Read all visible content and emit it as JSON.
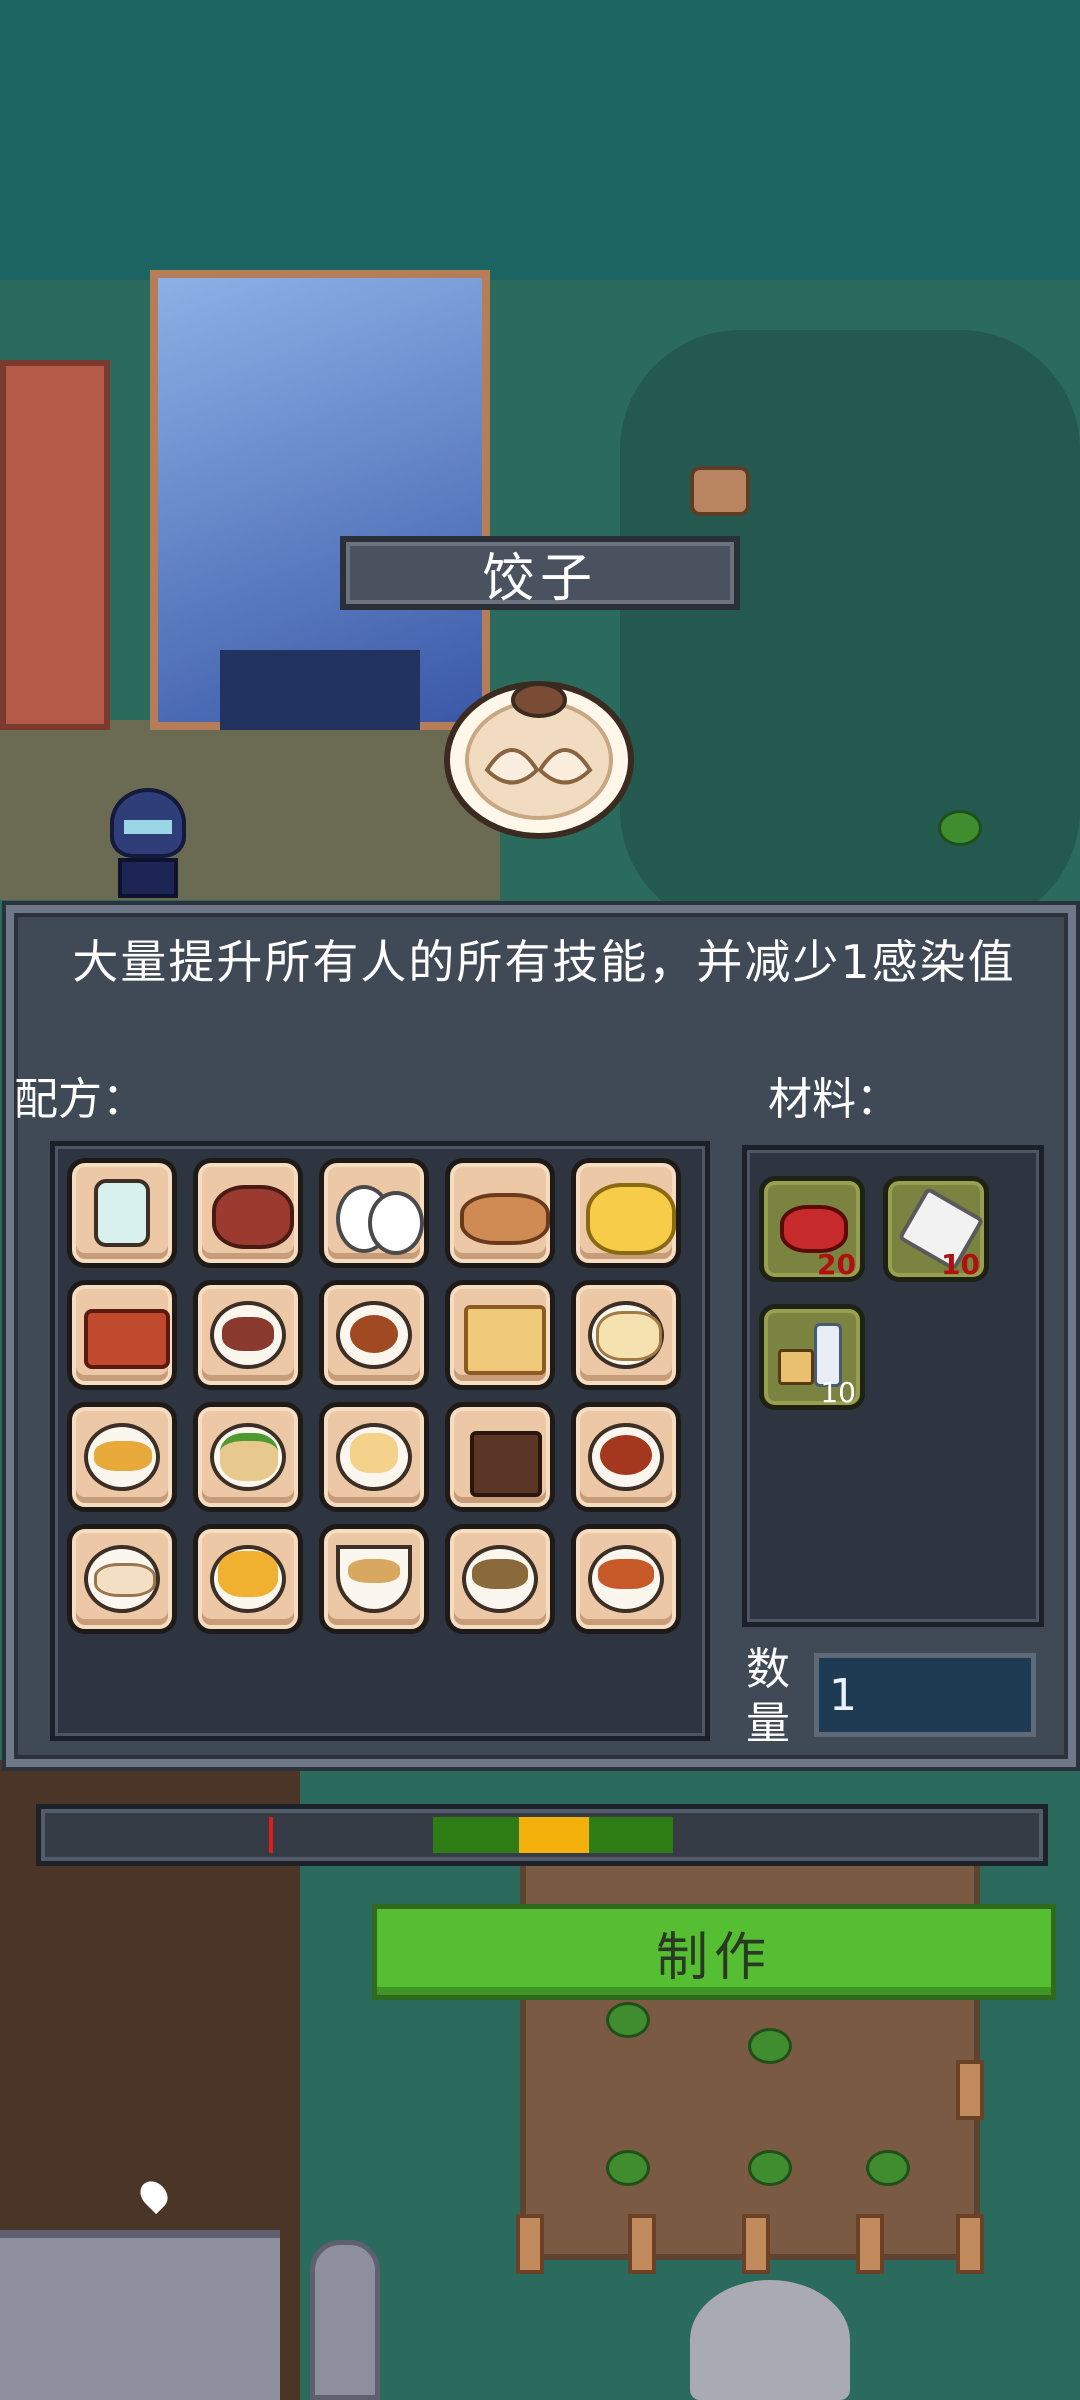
{
  "dish": {
    "name": "饺子"
  },
  "panel": {
    "description": "大量提升所有人的所有技能，并减少1感染值",
    "recipe_label": "配方：",
    "materials_label": "材料：",
    "recipes": [
      {
        "icon": "water-glass-icon"
      },
      {
        "icon": "steak-icon"
      },
      {
        "icon": "eggs-icon"
      },
      {
        "icon": "bread-icon"
      },
      {
        "icon": "scrambled-eggs-icon"
      },
      {
        "icon": "bacon-icon"
      },
      {
        "icon": "meat-platter-icon"
      },
      {
        "icon": "spaghetti-icon"
      },
      {
        "icon": "toast-icon"
      },
      {
        "icon": "pancake-icon"
      },
      {
        "icon": "taco-icon"
      },
      {
        "icon": "sandwich-icon"
      },
      {
        "icon": "bread-plate-icon"
      },
      {
        "icon": "cake-slice-icon"
      },
      {
        "icon": "meatballs-icon"
      },
      {
        "icon": "dumplings-icon"
      },
      {
        "icon": "rice-omelette-icon"
      },
      {
        "icon": "noodle-soup-icon"
      },
      {
        "icon": "salad-bowl-icon"
      },
      {
        "icon": "stew-bowl-icon"
      }
    ],
    "materials": [
      {
        "icon": "raw-meat-icon",
        "count": "20"
      },
      {
        "icon": "flour-icon",
        "count": "10"
      },
      {
        "icon": "seasoning-icon",
        "count": "10"
      }
    ],
    "quantity_label": "数量",
    "quantity_value": "1"
  },
  "craft": {
    "button_label": "制作"
  },
  "colors": {
    "meter_green": "#2d7d14",
    "meter_orange": "#f4b10c",
    "meter_cursor": "#e21b1b",
    "button_green": "#56be33"
  }
}
